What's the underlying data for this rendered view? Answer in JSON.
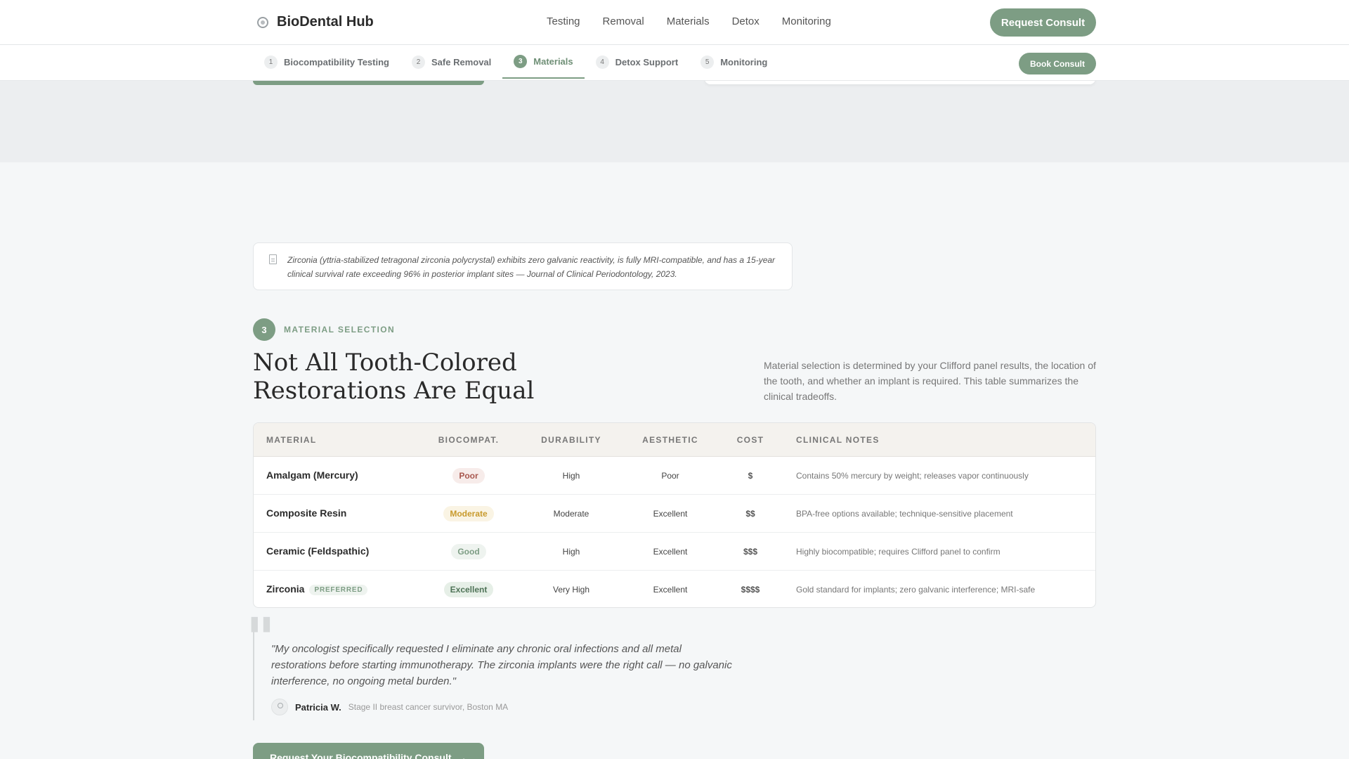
{
  "brand": {
    "name": "BioDental Hub",
    "icon": "tooth-icon"
  },
  "main_nav": [
    "Testing",
    "Removal",
    "Materials",
    "Detox",
    "Monitoring"
  ],
  "header_cta": "Request Consult",
  "steps": [
    {
      "num": "1",
      "label": "Biocompatibility Testing",
      "active": false
    },
    {
      "num": "2",
      "label": "Safe Removal",
      "active": false
    },
    {
      "num": "3",
      "label": "Materials",
      "active": true
    },
    {
      "num": "4",
      "label": "Detox Support",
      "active": false
    },
    {
      "num": "5",
      "label": "Monitoring",
      "active": false
    }
  ],
  "subnav_cta": "Book Consult",
  "citation": {
    "icon": "document-icon",
    "text": "Zirconia (yttria-stabilized tetragonal zirconia polycrystal) exhibits zero galvanic reactivity, is fully MRI-compatible, and has a 15-year clinical survival rate exceeding 96% in posterior implant sites — Journal of Clinical Periodontology, 2023."
  },
  "section": {
    "number": "3",
    "eyebrow": "MATERIAL SELECTION",
    "title": "Not All Tooth-Colored Restorations Are Equal",
    "description": "Material selection is determined by your Clifford panel results, the location of the tooth, and whether an implant is required. This table summarizes the clinical tradeoffs."
  },
  "table": {
    "headers": [
      "MATERIAL",
      "BIOCOMPAT.",
      "DURABILITY",
      "AESTHETIC",
      "COST",
      "CLINICAL NOTES"
    ],
    "rows": [
      {
        "material": "Amalgam (Mercury)",
        "badge": "",
        "biocompat": "Poor",
        "level": "poor",
        "durability": "High",
        "aesthetic": "Poor",
        "cost": "$",
        "notes": "Contains 50% mercury by weight; releases vapor continuously"
      },
      {
        "material": "Composite Resin",
        "badge": "",
        "biocompat": "Moderate",
        "level": "moderate",
        "durability": "Moderate",
        "aesthetic": "Excellent",
        "cost": "$$",
        "notes": "BPA-free options available; technique-sensitive placement"
      },
      {
        "material": "Ceramic (Feldspathic)",
        "badge": "",
        "biocompat": "Good",
        "level": "good",
        "durability": "High",
        "aesthetic": "Excellent",
        "cost": "$$$",
        "notes": "Highly biocompatible; requires Clifford panel to confirm"
      },
      {
        "material": "Zirconia",
        "badge": "PREFERRED",
        "biocompat": "Excellent",
        "level": "excellent",
        "durability": "Very High",
        "aesthetic": "Excellent",
        "cost": "$$$$",
        "notes": "Gold standard for implants; zero galvanic interference; MRI-safe"
      }
    ]
  },
  "testimonial": {
    "quote": "\"My oncologist specifically requested I eliminate any chronic oral infections and all metal restorations before starting immunotherapy. The zirconia implants were the right call — no galvanic interference, no ongoing metal burden.\"",
    "author": "Patricia W.",
    "meta": "Stage II breast cancer survivor, Boston MA"
  },
  "cta": {
    "label": "Request Your Biocompatibility Consult",
    "icon": "arrow-right-icon"
  },
  "colors": {
    "accent": "#7d9d84",
    "poor": "#a8574e",
    "moderate": "#c89a2c",
    "excellent": "#4f7357"
  }
}
